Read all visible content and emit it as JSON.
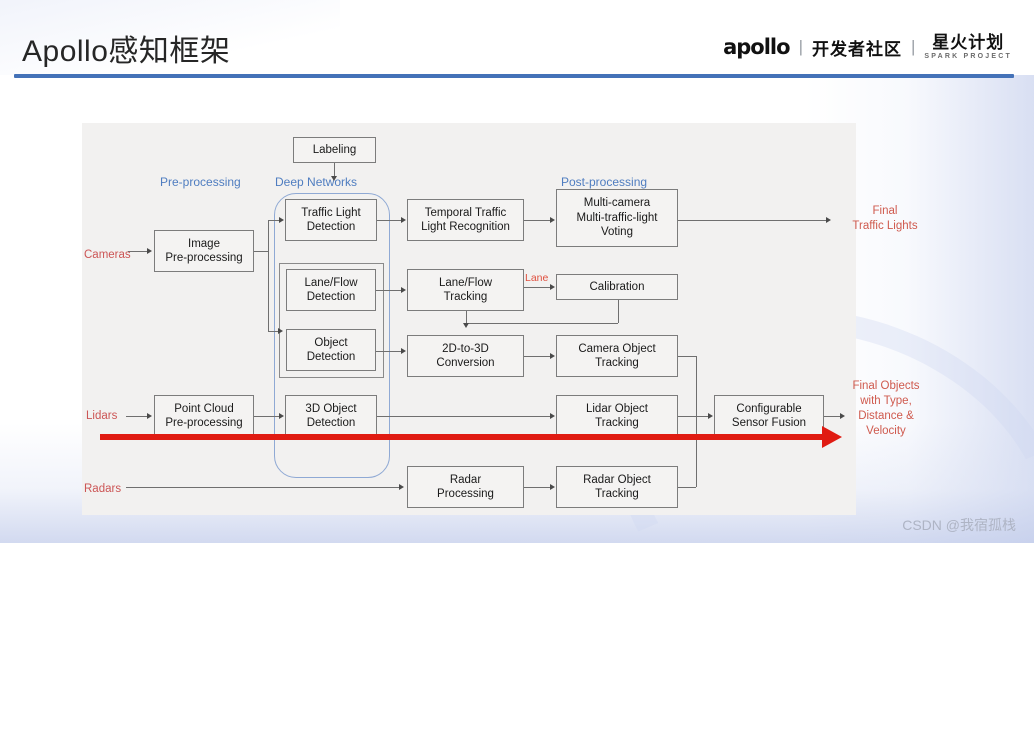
{
  "header": {
    "title": "Apollo感知框架",
    "brand": {
      "apollo": "apollo",
      "sep1": "|",
      "community": "开发者社区",
      "sep2": "|",
      "spark_cn": "星火计划",
      "spark_en": "SPARK PROJECT"
    }
  },
  "diagram": {
    "section_labels": [
      {
        "id": "pre-processing",
        "text": "Pre-processing"
      },
      {
        "id": "deep-networks",
        "text": "Deep Networks"
      },
      {
        "id": "post-processing",
        "text": "Post-processing"
      }
    ],
    "sources": [
      {
        "id": "cameras",
        "text": "Cameras"
      },
      {
        "id": "lidars",
        "text": "Lidars"
      },
      {
        "id": "radars",
        "text": "Radars"
      }
    ],
    "nodes": {
      "labeling": "Labeling",
      "image_pre": "Image\nPre-processing",
      "traffic_light_detection": "Traffic Light\nDetection",
      "lane_flow_detection": "Lane/Flow\nDetection",
      "object_detection": "Object\nDetection",
      "object_3d_detection": "3D Object\nDetection",
      "temporal_traffic": "Temporal Traffic\nLight Recognition",
      "lane_flow_tracking": "Lane/Flow\nTracking",
      "conversion_2d3d": "2D-to-3D\nConversion",
      "point_cloud_pre": "Point Cloud\nPre-processing",
      "radar_processing": "Radar\nProcessing",
      "multi_camera_voting": "Multi-camera\nMulti-traffic-light\nVoting",
      "calibration": "Calibration",
      "camera_object_tracking": "Camera Object\nTracking",
      "lidar_object_tracking": "Lidar Object\nTracking",
      "radar_object_tracking": "Radar Object\nTracking",
      "sensor_fusion": "Configurable\nSensor Fusion"
    },
    "edge_labels": [
      {
        "id": "lane",
        "text": "Lane"
      }
    ],
    "outputs": [
      {
        "id": "final-traffic-lights",
        "text": "Final\nTraffic Lights"
      },
      {
        "id": "final-objects",
        "text": "Final Objects\nwith Type,\nDistance &\nVelocity"
      }
    ]
  },
  "watermark": "CSDN @我宿孤栈",
  "colors": {
    "accent_blue": "#4472b8",
    "section_label": "#4f7dc0",
    "source_red": "#cc5555",
    "output_red": "#cf5a4e",
    "highlight_red": "#e01b12",
    "deep_net_border": "#8fa9d4",
    "panel_bg": "#f2f1f0"
  }
}
